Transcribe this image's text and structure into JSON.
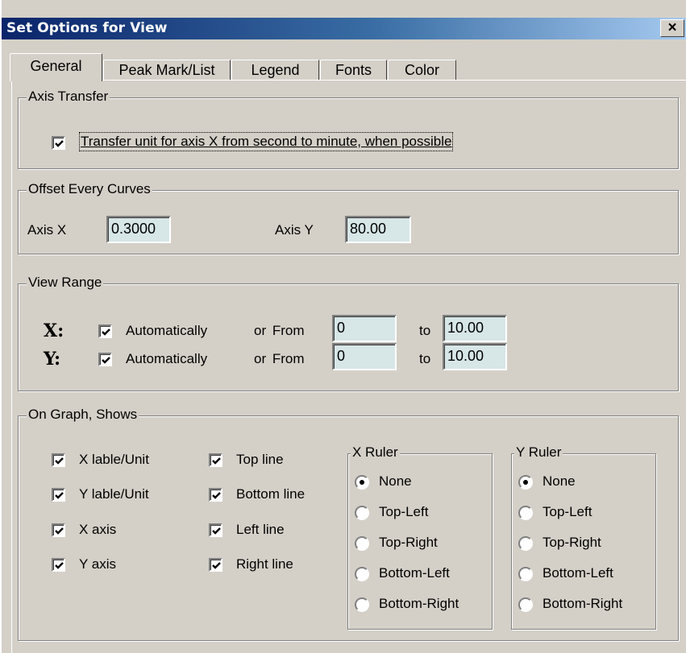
{
  "window": {
    "title": "Set Options for View",
    "close_label": "×"
  },
  "tabs": [
    {
      "label": "General",
      "active": true
    },
    {
      "label": "Peak Mark/List",
      "active": false
    },
    {
      "label": "Legend",
      "active": false
    },
    {
      "label": "Fonts",
      "active": false
    },
    {
      "label": "Color",
      "active": false
    }
  ],
  "axis_transfer": {
    "title": "Axis Transfer",
    "checkbox_label": "Transfer unit for axis X from second to minute, when possible",
    "checked": true
  },
  "offset": {
    "title": "Offset Every Curves",
    "axis_x_label": "Axis X",
    "axis_x_value": "0.3000",
    "axis_y_label": "Axis Y",
    "axis_y_value": "80.00"
  },
  "view_range": {
    "title": "View Range",
    "x": {
      "label": "X:",
      "auto_label": "Automatically",
      "auto_checked": true,
      "from_label": "or  From",
      "from_value": "0",
      "to_label": "to",
      "to_value": "10.00"
    },
    "y": {
      "label": "Y:",
      "auto_label": "Automatically",
      "auto_checked": true,
      "from_label": "or  From",
      "from_value": "0",
      "to_label": "to",
      "to_value": "10.00"
    }
  },
  "on_graph": {
    "title": "On Graph, Shows",
    "col1": [
      {
        "label": "X lable/Unit",
        "checked": true
      },
      {
        "label": "Y lable/Unit",
        "checked": true
      },
      {
        "label": "X axis",
        "checked": true
      },
      {
        "label": "Y axis",
        "checked": true
      }
    ],
    "col2": [
      {
        "label": "Top line",
        "checked": true
      },
      {
        "label": "Bottom line",
        "checked": true
      },
      {
        "label": "Left line",
        "checked": true
      },
      {
        "label": "Right line",
        "checked": true
      }
    ],
    "x_ruler": {
      "title": "X Ruler",
      "options": [
        "None",
        "Top-Left",
        "Top-Right",
        "Bottom-Left",
        "Bottom-Right"
      ],
      "selected": "None"
    },
    "y_ruler": {
      "title": "Y Ruler",
      "options": [
        "None",
        "Top-Left",
        "Top-Right",
        "Bottom-Left",
        "Bottom-Right"
      ],
      "selected": "None"
    }
  }
}
